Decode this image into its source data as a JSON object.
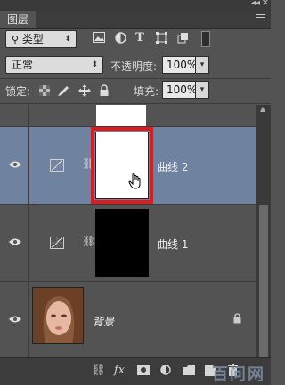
{
  "panel": {
    "tab_label": "图层"
  },
  "filter": {
    "kind_label": "类型",
    "icons": [
      "image-filter-icon",
      "adjustment-filter-icon",
      "type-filter-icon",
      "shape-filter-icon",
      "smart-object-filter-icon",
      "filter-toggle-icon"
    ]
  },
  "blend": {
    "mode": "正常",
    "opacity_label": "不透明度:",
    "opacity_value": "100%"
  },
  "lock": {
    "label": "锁定:",
    "fill_label": "填充:",
    "fill_value": "100%"
  },
  "layers": [
    {
      "name": "",
      "type": "curves",
      "mask": "white"
    },
    {
      "name": "曲线 2",
      "type": "curves",
      "mask": "white",
      "selected": true
    },
    {
      "name": "曲线 1",
      "type": "curves",
      "mask": "black"
    },
    {
      "name": "背景",
      "type": "image",
      "locked": true
    }
  ],
  "selection_color": "#6f82a0",
  "highlight_color": "#e01a1a",
  "bottom_bar": {
    "fx_label": "fx",
    "watermark": "百问网"
  }
}
